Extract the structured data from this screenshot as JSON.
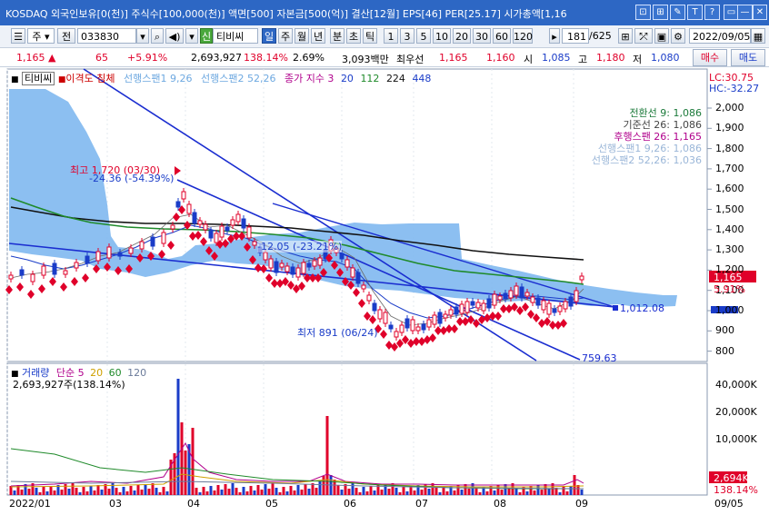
{
  "window": {
    "title": "KOSDAQ 외국인보유[0(천)] 주식수[100,000(천)] 액면[500] 자본금[500(억)] 결산[12월] EPS[46] PER[25.17] 시가총액[1,16",
    "controls": [
      "⊡",
      "⊞",
      "✎",
      "T",
      "?",
      "▭",
      "—",
      "▢",
      "✕"
    ]
  },
  "toolbar": {
    "mode": "주",
    "prefix": "전",
    "code": "033830",
    "name_badge": "신",
    "name": "티비씨",
    "periods": [
      "일",
      "주",
      "월",
      "년",
      "분",
      "초",
      "틱"
    ],
    "active_period": "일",
    "numbers": [
      "1",
      "3",
      "5",
      "10",
      "20",
      "30",
      "60",
      "120"
    ],
    "count_value": "181",
    "count_total": "/625",
    "date": "2022/09/05"
  },
  "price_bar": {
    "price": "1,165 ▲",
    "change": "65",
    "change_pct": "+5.91%",
    "volume": "2,693,927",
    "volume_ratio": "138.14%",
    "turnover": "2.69%",
    "amount": "3,093백만",
    "best_ask_label": "최우선",
    "best_ask": "1,165",
    "best_bid": "1,160",
    "open_label": "시",
    "open": "1,085",
    "high_label": "고",
    "high": "1,180",
    "low_label": "저",
    "low": "1,080",
    "buy_label": "매수",
    "sell_label": "매도"
  },
  "legend": {
    "name": "티비씨",
    "disparity": "이격도 침체",
    "span1": "선행스팬1 9,26",
    "span2": "선행스팬2 52,26",
    "close_index": "종가 지수 3",
    "ma_periods": [
      "20",
      "112",
      "224",
      "448"
    ]
  },
  "scale_info": {
    "lc": "LC:30.75",
    "hc": "HC:-32.27"
  },
  "ichimoku_labels": [
    {
      "text": "전환선 9: 1,086",
      "color": "#1b7a3a"
    },
    {
      "text": "기준선 26: 1,086",
      "color": "#444444"
    },
    {
      "text": "후행스팬 26: 1,165",
      "color": "#b0008c"
    },
    {
      "text": "선행스팬1 9,26: 1,086",
      "color": "#9ab6d8"
    },
    {
      "text": "선행스팬2 52,26: 1,036",
      "color": "#9ab6d8"
    }
  ],
  "annotations": {
    "high": "최고 1,720 (03/30)",
    "high_diff": "-24.36 (-54.39%)",
    "mid_diff": "-12.05 (-23.21%)",
    "low": "최저 891 (06/24)",
    "trend_end_1": "1,012.08",
    "trend_end_2": "759.63",
    "last_price_tag": "1,165",
    "last_pct_tag": "5.91%"
  },
  "price_axis": [
    "2,000",
    "1,900",
    "1,800",
    "1,700",
    "1,600",
    "1,500",
    "1,400",
    "1,300",
    "1,200",
    "1,100",
    "1,000",
    "900",
    "800"
  ],
  "volume_legend": {
    "name": "거래량",
    "ma_label": "단순",
    "ma_periods": [
      "5",
      "20",
      "60",
      "120"
    ],
    "current": "2,693,927주(138.14%)"
  },
  "volume_axis": [
    "40,000K",
    "20,000K",
    "10,000K",
    "2,694K",
    "138.14%"
  ],
  "time_axis": [
    "2022/01",
    "03",
    "04",
    "05",
    "06",
    "07",
    "08",
    "09"
  ],
  "time_axis_right": "09/05",
  "colors": {
    "up": "#e0002a",
    "down": "#1a3cc8",
    "cloud": "#7fb8ef",
    "ma20": "#1a3cc8",
    "ma112": "#1f8a2a",
    "ma224": "#111111",
    "title_bar": "#2d67c4"
  }
}
